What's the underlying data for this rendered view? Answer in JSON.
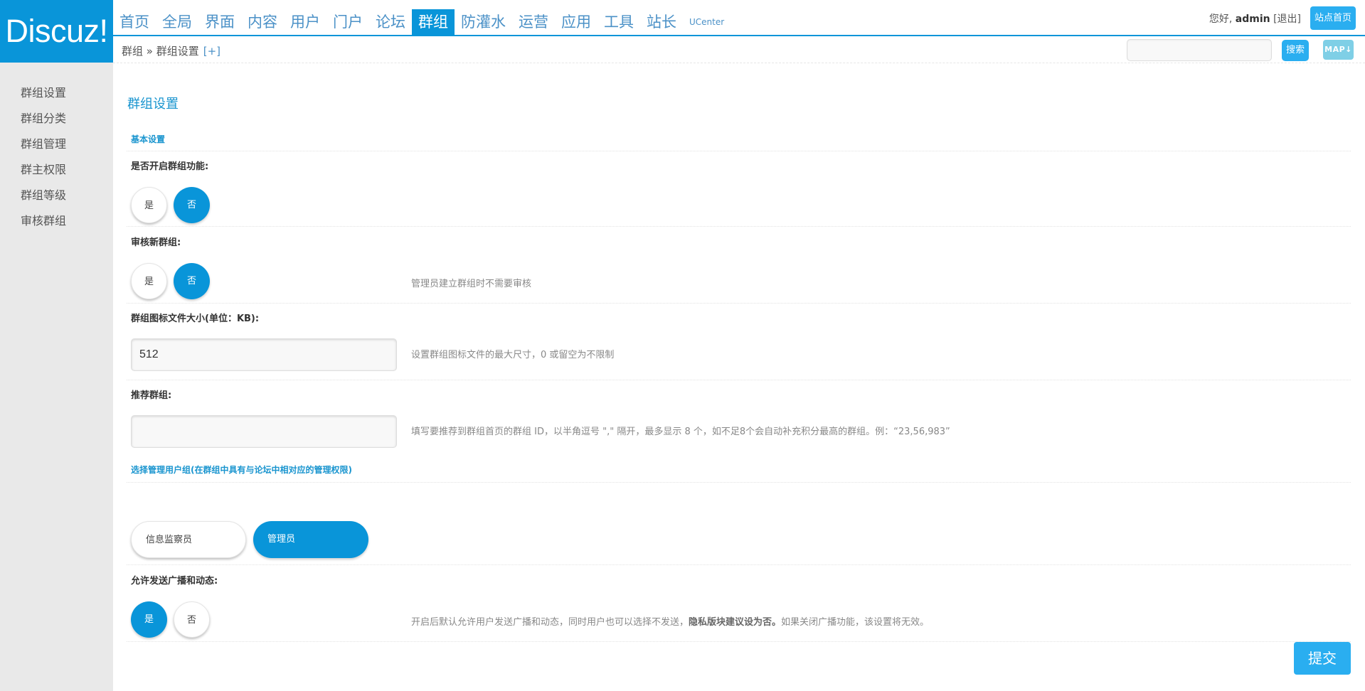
{
  "logo": {
    "text": "Discuz!"
  },
  "nav": {
    "items": [
      {
        "label": "首页"
      },
      {
        "label": "全局"
      },
      {
        "label": "界面"
      },
      {
        "label": "内容"
      },
      {
        "label": "用户"
      },
      {
        "label": "门户"
      },
      {
        "label": "论坛"
      },
      {
        "label": "群组",
        "active": true
      },
      {
        "label": "防灌水"
      },
      {
        "label": "运营"
      },
      {
        "label": "应用"
      },
      {
        "label": "工具"
      },
      {
        "label": "站长"
      },
      {
        "label": "UCenter"
      }
    ]
  },
  "user": {
    "greeting": "您好,",
    "name": "admin",
    "logout": "[退出]",
    "home_button": "站点首页"
  },
  "breadcrumb": {
    "text": "群组 » 群组设置",
    "add": "[+]"
  },
  "search": {
    "value": "",
    "button": "搜索",
    "map_button": "MAP↓"
  },
  "sidebar": {
    "items": [
      {
        "label": "群组设置"
      },
      {
        "label": "群组分类"
      },
      {
        "label": "群组管理"
      },
      {
        "label": "群主权限"
      },
      {
        "label": "群组等级"
      },
      {
        "label": "审核群组"
      }
    ]
  },
  "main": {
    "title": "群组设置",
    "basic_section": "基本设置",
    "enable": {
      "label": "是否开启群组功能:",
      "yes": "是",
      "no": "否",
      "selected": "no"
    },
    "audit": {
      "label": "审核新群组:",
      "yes": "是",
      "no": "否",
      "selected": "no",
      "hint": "管理员建立群组时不需要审核"
    },
    "icon_size": {
      "label": "群组图标文件大小(单位：KB):",
      "value": "512",
      "hint": "设置群组图标文件的最大尺寸，0 或留空为不限制"
    },
    "recommend": {
      "label": "推荐群组:",
      "value": "",
      "hint": "填写要推荐到群组首页的群组 ID，以半角逗号 \",\" 隔开，最多显示 8 个，如不足8个会自动补充积分最高的群组。例：“23,56,983”"
    },
    "manage_section": "选择管理用户组(在群组中具有与论坛中相对应的管理权限)",
    "groups": {
      "option1": "信息监察员",
      "option2": "管理员"
    },
    "broadcast": {
      "label": "允许发送广播和动态:",
      "yes": "是",
      "no": "否",
      "selected": "yes",
      "hint_a": "开启后默认允许用户发送广播和动态，同时用户也可以选择不发送，",
      "hint_b": "隐私版块建议设为否。",
      "hint_c": "如果关闭广播功能，该设置将无效。"
    },
    "submit": "提交"
  }
}
